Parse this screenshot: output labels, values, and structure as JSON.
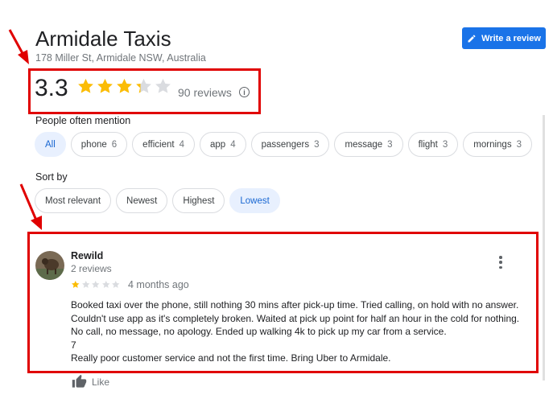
{
  "business": {
    "name": "Armidale Taxis",
    "address": "178 Miller St, Armidale NSW, Australia",
    "rating": "3.3",
    "rating_value": 3.3,
    "reviews_count": "90 reviews",
    "info_glyph": "i"
  },
  "write_review": {
    "label": "Write a review",
    "icon": "pencil-icon"
  },
  "mentions": {
    "label": "People often mention",
    "chips": [
      {
        "label": "All",
        "count": ""
      },
      {
        "label": "phone",
        "count": "6"
      },
      {
        "label": "efficient",
        "count": "4"
      },
      {
        "label": "app",
        "count": "4"
      },
      {
        "label": "passengers",
        "count": "3"
      },
      {
        "label": "message",
        "count": "3"
      },
      {
        "label": "flight",
        "count": "3"
      },
      {
        "label": "mornings",
        "count": "3"
      }
    ]
  },
  "sort": {
    "label": "Sort by",
    "options": [
      "Most relevant",
      "Newest",
      "Highest",
      "Lowest"
    ],
    "selected": "Lowest"
  },
  "review": {
    "author": "Rewild",
    "author_sub": "2 reviews",
    "stars": 1,
    "date": "4 months ago",
    "text_lines": [
      "Booked taxi over the phone, still nothing 30 mins after pick-up time. Tried calling, on hold with no answer. Couldn't use app as it's completely broken. Waited at pick up point for half an hour in the cold for nothing. No call, no message, no apology. Ended up walking 4k to pick up my car from a service.",
      "7",
      "Really poor customer service and not the first time. Bring Uber to Armidale."
    ],
    "like_label": "Like"
  },
  "colors": {
    "accent": "#1a73e8",
    "star": "#fbbc04",
    "star_empty": "#dadce0",
    "annotation_red": "#e00000"
  }
}
